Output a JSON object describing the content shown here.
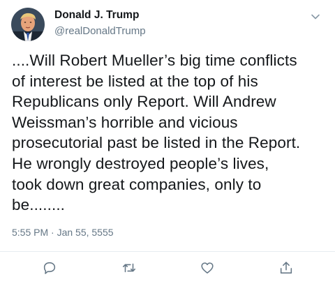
{
  "tweet": {
    "author": {
      "display_name": "Donald J. Trump",
      "handle": "@realDonaldTrump"
    },
    "text_lines": [
      "....Will Robert Mueller’s big time conflicts",
      "of interest be listed at the top of his",
      "Republicans only Report. Will Andrew",
      "Weissman’s horrible and vicious",
      "prosecutorial past be listed in the Report.",
      "He wrongly destroyed people’s lives,",
      "took down great companies, only to",
      "be........"
    ],
    "timestamp": "5:55 PM · Jan 55, 5555"
  },
  "icons": {
    "menu": "chevron-down-icon",
    "reply": "reply-icon",
    "retweet": "retweet-icon",
    "like": "heart-icon",
    "share": "share-icon"
  },
  "colors": {
    "text": "#14171a",
    "secondary": "#657786",
    "divider": "#e6ecf0",
    "icon": "#657786"
  }
}
